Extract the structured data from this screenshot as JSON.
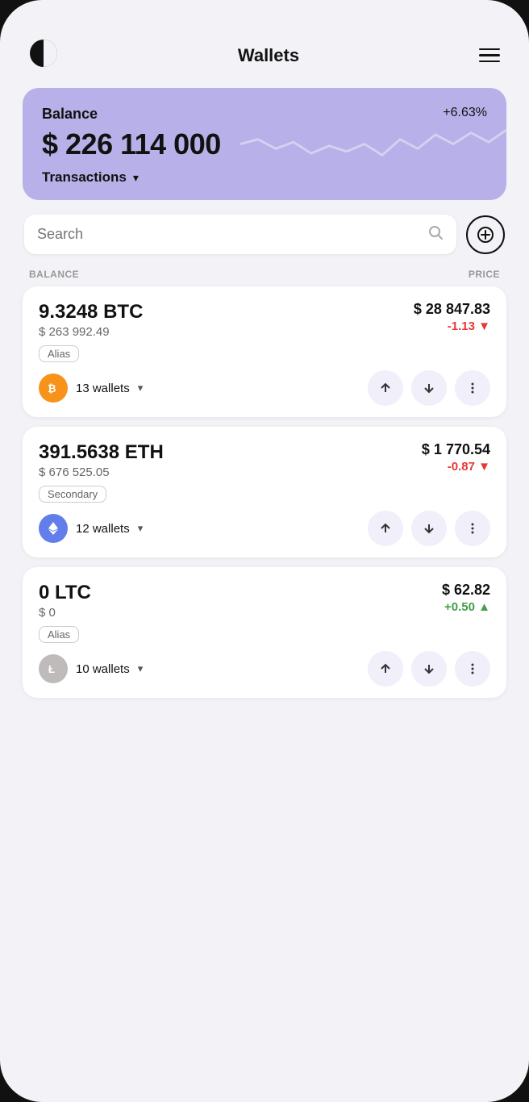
{
  "header": {
    "title": "Wallets",
    "logo": "half-circle",
    "menu_icon": "hamburger"
  },
  "balance_card": {
    "label": "Balance",
    "amount": "$ 226 114 000",
    "change": "+6.63%",
    "transactions_label": "Transactions"
  },
  "search": {
    "placeholder": "Search",
    "add_label": "+"
  },
  "column_headers": {
    "left": "BALANCE",
    "right": "PRICE"
  },
  "assets": [
    {
      "id": "btc",
      "amount": "9.3248 BTC",
      "usd_value": "$ 263 992.49",
      "price": "$ 28 847.83",
      "change": "-1.13 ▼",
      "change_type": "negative",
      "tag": "Alias",
      "wallet_count": "13 wallets",
      "coin_symbol": "₿",
      "coin_class": "coin-btc"
    },
    {
      "id": "eth",
      "amount": "391.5638 ETH",
      "usd_value": "$ 676 525.05",
      "price": "$ 1 770.54",
      "change": "-0.87 ▼",
      "change_type": "negative",
      "tag": "Secondary",
      "wallet_count": "12 wallets",
      "coin_symbol": "⟠",
      "coin_class": "coin-eth"
    },
    {
      "id": "ltc",
      "amount": "0 LTC",
      "usd_value": "$ 0",
      "price": "$ 62.82",
      "change": "+0.50 ▲",
      "change_type": "positive",
      "tag": "Alias",
      "wallet_count": "10 wallets",
      "coin_symbol": "Ł",
      "coin_class": "coin-ltc"
    }
  ]
}
